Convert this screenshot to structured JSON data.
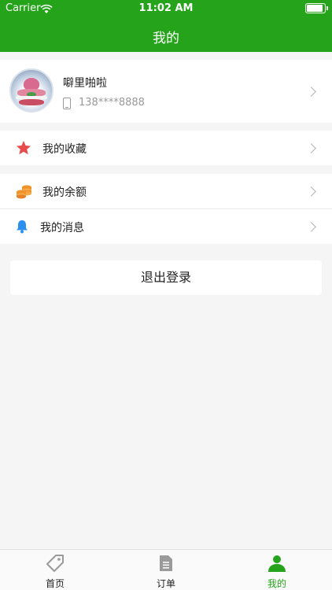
{
  "status_bar": {
    "carrier": "Carrier",
    "time": "11:02 AM",
    "battery_level": 0.9
  },
  "nav": {
    "title": "我的"
  },
  "profile": {
    "name": "噼里啪啦",
    "phone": "138****8888"
  },
  "menu": [
    {
      "label": "我的收藏",
      "icon": "star-icon"
    },
    {
      "label": "我的余额",
      "icon": "coins-icon"
    },
    {
      "label": "我的消息",
      "icon": "bell-icon"
    }
  ],
  "logout": {
    "label": "退出登录"
  },
  "tabbar": {
    "items": [
      {
        "label": "首页",
        "icon": "tag-icon",
        "active": false
      },
      {
        "label": "订单",
        "icon": "document-icon",
        "active": false
      },
      {
        "label": "我的",
        "icon": "person-icon",
        "active": true
      }
    ]
  },
  "colors": {
    "brand": "#25a31a",
    "star": "#e84b4b",
    "coins": "#f0932b",
    "bell": "#2b8ff0",
    "inactive_tab": "#9a9a9a"
  }
}
